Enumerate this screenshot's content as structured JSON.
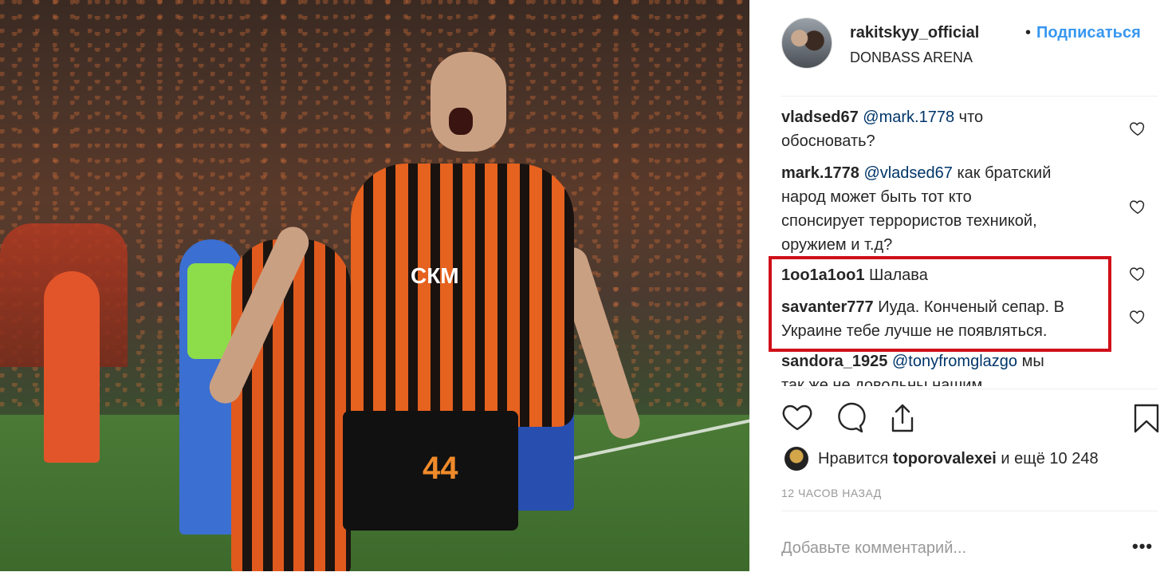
{
  "post": {
    "username": "rakitskyy_official",
    "separator": "•",
    "follow_label": "Подписаться",
    "location": "DONBASS ARENA",
    "photo_jersey_number": "44",
    "photo_sponsor_text": "СКМ"
  },
  "comments": [
    {
      "user": "vladsed67",
      "mention": "@mark.1778",
      "text_line1": " что",
      "text_line2": "обосновать?"
    },
    {
      "user": "mark.1778",
      "mention": "@vladsed67",
      "text_line1": " как братский",
      "text_line2": "народ может быть тот кто",
      "text_line3": "спонсирует террористов техникой,",
      "text_line4": "оружием и т.д?"
    },
    {
      "user": "1oo1a1oo1",
      "text": "Шалава"
    },
    {
      "user": "savanter777",
      "text_line1": "Иуда. Конченый сепар. В",
      "text_line2": "Украине тебе лучше не появляться."
    },
    {
      "user": "sandora_1925",
      "mention": "@tonyfromglazgo",
      "text_line1": " мы",
      "text_line2": "так же не довольны нашим"
    }
  ],
  "likes": {
    "prefix": "Нравится ",
    "user": "toporovalexei",
    "suffix": " и ещё 10 248"
  },
  "timestamp": "12 ЧАСОВ НАЗАД",
  "add_comment_placeholder": "Добавьте комментарий...",
  "more_label": "•••",
  "colors": {
    "link": "#3897f0",
    "mention": "#003569",
    "highlight_border": "#d0101a"
  },
  "icons": [
    "heart-icon",
    "comment-icon",
    "share-icon",
    "bookmark-icon",
    "more-options-icon"
  ]
}
